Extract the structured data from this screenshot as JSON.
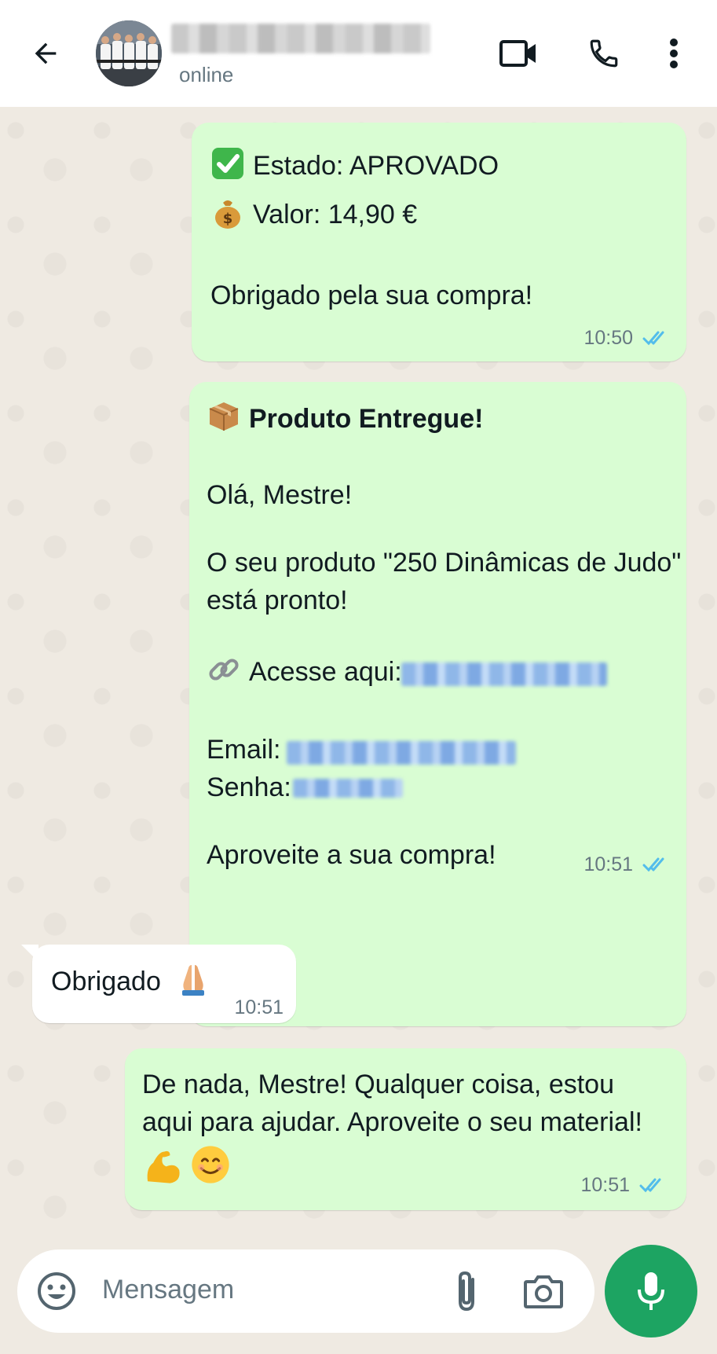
{
  "header": {
    "status": "online"
  },
  "messages": {
    "m1": {
      "line1": "Estado: APROVADO",
      "line2": "Valor: 14,90 €",
      "line3": "Obrigado pela sua compra!",
      "time": "10:50"
    },
    "m2": {
      "title": "Produto Entregue!",
      "greeting": "Olá, Mestre!",
      "body1": "O seu produto \"250 Dinâmicas de Judo\"",
      "body2": "está pronto!",
      "access": "Acesse aqui:",
      "email": "Email:",
      "password": "Senha:",
      "closing": "Aproveite a sua compra!",
      "time": "10:51"
    },
    "m3": {
      "text": "Obrigado",
      "time": "10:51"
    },
    "m4": {
      "line1": "De nada, Mestre! Qualquer coisa, estou",
      "line2": "aqui para ajudar. Aproveite o seu material!",
      "time": "10:51"
    }
  },
  "input": {
    "placeholder": "Mensagem"
  },
  "colors": {
    "outgoing_bubble": "#d9fdd3",
    "incoming_bubble": "#ffffff",
    "read_ticks": "#53bdeb",
    "mic_button": "#1da462"
  },
  "icons": {
    "back": "arrow-left-icon",
    "video": "video-camera-icon",
    "call": "phone-icon",
    "menu": "more-vert-icon",
    "emoji": "emoji-icon",
    "attach": "paperclip-icon",
    "camera": "camera-icon",
    "mic": "microphone-icon"
  }
}
